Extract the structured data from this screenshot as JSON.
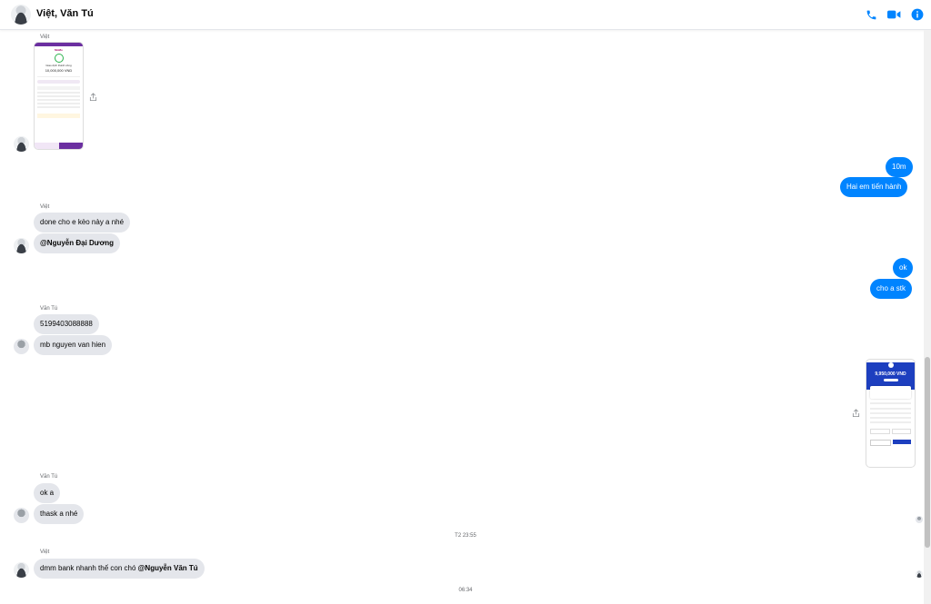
{
  "header": {
    "title": "Việt, Văn Tú"
  },
  "colors": {
    "accent": "#0084ff",
    "incoming": "#e4e6eb",
    "phone_purple": "#6b2fa0",
    "phone_blue": "#1d3fbf"
  },
  "messages": {
    "s1": "Việt",
    "s2": "Việt",
    "m_done": "done cho e kèo này a nhé",
    "m_mention1": "@Nguyễn Đại Dương",
    "out_10m": "10m",
    "out_hai": "Hai em tiến hành",
    "out_ok": "ok",
    "out_stk": "cho a stk",
    "s3": "Văn Tú",
    "m_acct": "5199403088888",
    "m_bank": "mb nguyen van hien",
    "s4": "Văn Tú",
    "m_oka": "ok a",
    "m_thask": "thask a nhé",
    "time1": "T2 23:55",
    "s5": "Việt",
    "m_dmm": "dmm bank nhanh thế con chó ",
    "m_mention2": "@Nguyễn Văn Tú",
    "time2": "06:34"
  },
  "images": {
    "img1": {
      "brand": "MoMo",
      "title": "Giao dịch thành công",
      "amount": "10,000,000 VND"
    },
    "img2": {
      "amount": "9,950,000 VND"
    }
  }
}
